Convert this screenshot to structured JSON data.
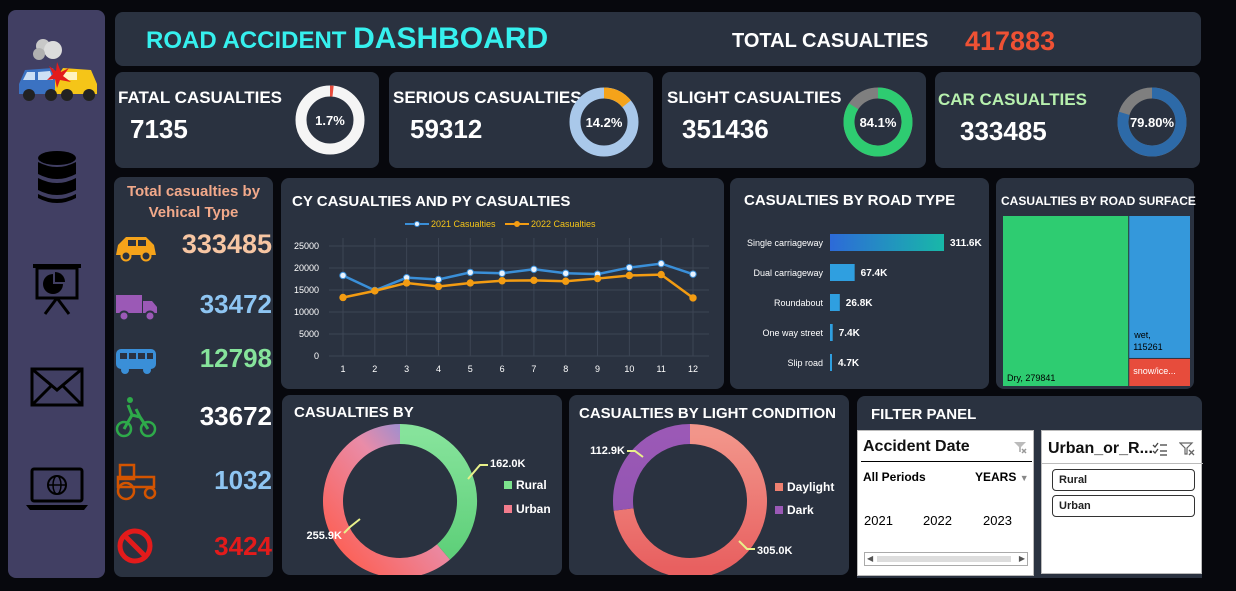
{
  "header": {
    "title_part1": "ROAD ACCIDENT ",
    "title_part2": "DASHBOARD",
    "total_label": "TOTAL CASUALTIES",
    "total_value": "417883"
  },
  "sidebar": {
    "items": [
      {
        "icon": "car-crash-icon"
      },
      {
        "icon": "database-icon"
      },
      {
        "icon": "presentation-icon"
      },
      {
        "icon": "mail-icon"
      },
      {
        "icon": "laptop-globe-icon"
      }
    ]
  },
  "kpis": [
    {
      "label": "FATAL  CASUALTIES",
      "value": "7135",
      "pct": "1.7%",
      "fraction": 0.017,
      "color": "#e84c3d",
      "track": "#f5f5f5"
    },
    {
      "label": "SERIOUS CASUALTIES",
      "value": "59312",
      "pct": "14.2%",
      "fraction": 0.142,
      "color": "#f5a31a",
      "track": "#a9c8ea"
    },
    {
      "label": "SLIGHT CASUALTIES",
      "value": "351436",
      "pct": "84.1%",
      "fraction": 0.841,
      "color": "#2ecc71",
      "track": "#7f7f7f"
    },
    {
      "label": "CAR CASUALTIES",
      "value": "333485",
      "pct": "79.80%",
      "fraction": 0.798,
      "color": "#2d6aa8",
      "track": "#7f7f7f"
    }
  ],
  "vehicle": {
    "title_line1": "Total casualties by",
    "title_line2": "Vehical Type",
    "rows": [
      {
        "icon": "car-icon",
        "value": "333485",
        "color": "#f7c6a3",
        "icon_color": "#f5a31a"
      },
      {
        "icon": "truck-icon",
        "value": "33472",
        "color": "#8ec5f2",
        "icon_color": "#9b59b6"
      },
      {
        "icon": "bus-icon",
        "value": "12798",
        "color": "#86e39b",
        "icon_color": "#3a8fd8"
      },
      {
        "icon": "bicycle-icon",
        "value": "33672",
        "color": "#ffffff",
        "icon_color": "#2eaa4a"
      },
      {
        "icon": "tractor-icon",
        "value": "1032",
        "color": "#8ec5f2",
        "icon_color": "#d35400"
      },
      {
        "icon": "no-entry-icon",
        "value": "3424",
        "color": "#e31b1b",
        "icon_color": "#e31b1b"
      }
    ]
  },
  "line_chart": {
    "title": "CY CASUALTIES AND PY CASUALTIES",
    "colors": {
      "s2021": "#3a8fd8",
      "s2022": "#f39c12"
    }
  },
  "road_type": {
    "title": "CASUALTIES BY ROAD TYPE"
  },
  "road_surface": {
    "title": "CASUALTIES BY ROAD SURFACE"
  },
  "location": {
    "title": "CASUALTIES BY"
  },
  "light": {
    "title": "CASUALTIES BY LIGHT CONDITION"
  },
  "filter": {
    "title": "FILTER PANEL",
    "date_slicer": {
      "title": "Accident Date",
      "all_periods": "All Periods",
      "years_label": "YEARS",
      "years": [
        "2021",
        "2022",
        "2023"
      ]
    },
    "urban_slicer": {
      "title": "Urban_or_R...",
      "options": [
        "Rural",
        "Urban"
      ]
    }
  },
  "chart_data": [
    {
      "type": "line",
      "title": "CY CASUALTIES AND PY CASUALTIES",
      "x": [
        1,
        2,
        3,
        4,
        5,
        6,
        7,
        8,
        9,
        10,
        11,
        12
      ],
      "ylim": [
        0,
        25000
      ],
      "yticks": [
        "25000",
        "20000",
        "15000",
        "10000",
        "5000",
        "0"
      ],
      "grid": true,
      "legend": "top",
      "series": [
        {
          "name": "2021 Casualties",
          "values": [
            18300,
            14900,
            17800,
            17400,
            19000,
            18800,
            19700,
            18800,
            18600,
            20100,
            21000,
            18600
          ]
        },
        {
          "name": "2022 Casualties",
          "values": [
            13300,
            14800,
            16600,
            15800,
            16600,
            17100,
            17200,
            17000,
            17600,
            18300,
            18500,
            13200
          ]
        }
      ]
    },
    {
      "type": "bar",
      "title": "CASUALTIES BY ROAD TYPE",
      "orientation": "horizontal",
      "categories": [
        "Single carriageway",
        "Dual carriageway",
        "Roundabout",
        "One way street",
        "Slip road"
      ],
      "values": [
        311.6,
        67.4,
        26.8,
        7.4,
        4.7
      ],
      "labels": [
        "311.6K",
        "67.4K",
        "26.8K",
        "7.4K",
        "4.7K"
      ],
      "unit": "K",
      "color": "#2f9fe0"
    },
    {
      "type": "treemap",
      "title": "CASUALTIES BY ROAD SURFACE",
      "categories": [
        "Dry",
        "wet",
        "snow/ice..."
      ],
      "values": [
        279841,
        115261,
        22781
      ],
      "labels": [
        "Dry, 279841",
        "wet, 115261",
        "snow/ice..."
      ],
      "colors": [
        "#2ecc71",
        "#3498db",
        "#e74c3c"
      ]
    },
    {
      "type": "pie",
      "title": "CASUALTIES BY",
      "categories": [
        "Rural",
        "Urban"
      ],
      "values": [
        162.0,
        255.9
      ],
      "labels": [
        "162.0K",
        "255.9K"
      ],
      "colors": [
        "#7de38d",
        "#f27c8c"
      ],
      "legend": "right"
    },
    {
      "type": "pie",
      "title": "CASUALTIES BY LIGHT CONDITION",
      "categories": [
        "Daylight",
        "Dark"
      ],
      "values": [
        305.0,
        112.9
      ],
      "labels": [
        "305.0K",
        "112.9K"
      ],
      "colors": [
        "#ee8070",
        "#9b59b6"
      ],
      "legend": "right"
    }
  ]
}
